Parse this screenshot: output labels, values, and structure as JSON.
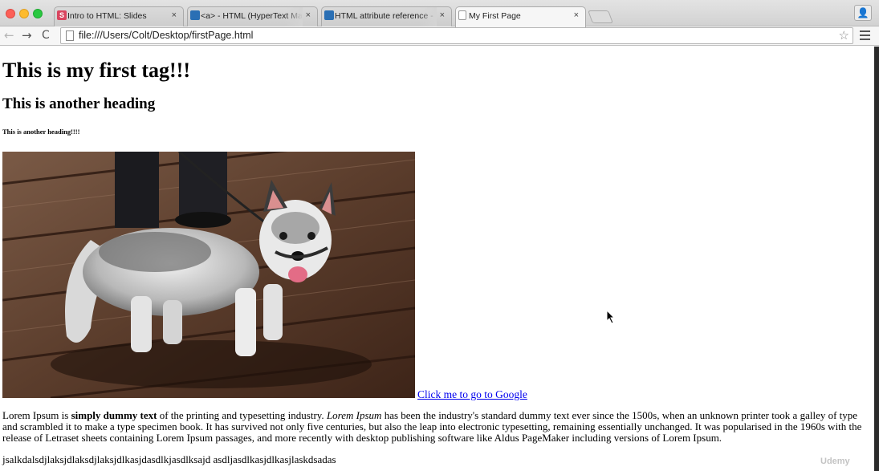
{
  "browser": {
    "tabs": [
      {
        "favicon": "slides-icon",
        "title": "Intro to HTML: Slides",
        "active": false
      },
      {
        "favicon": "mdn-icon",
        "title": "<a> - HTML (HyperText Ma",
        "active": false
      },
      {
        "favicon": "mdn-icon",
        "title": "HTML attribute reference -",
        "active": false
      },
      {
        "favicon": "document-icon",
        "title": "My First Page",
        "active": true
      }
    ],
    "favicon_letter": "S",
    "close_glyph": "×",
    "url": "file:///Users/Colt/Desktop/firstPage.html",
    "nav": {
      "back": "←",
      "forward": "→",
      "reload": "C",
      "star": "☆",
      "profile": "👤"
    },
    "colors": {
      "close": "#fc5f57",
      "minimize": "#fdbb2e",
      "maximize": "#29c840"
    }
  },
  "page": {
    "h1": "This is my first tag!!!",
    "h2": "This is another heading",
    "h6": "This is another heading!!!!",
    "image_alt": "husky-puppy-photo",
    "link_text": "Click me to go to Google",
    "paragraph": {
      "part1": "Lorem Ipsum is ",
      "bold": "simply dummy text",
      "part2": " of the printing and typesetting industry. ",
      "italic": "Lorem Ipsum",
      "part3": " has been the industry's standard dummy text ever since the 1500s, when an unknown printer took a galley of type and scrambled it to make a type specimen book. It has survived not only five centuries, but also the leap into electronic typesetting, remaining essentially unchanged. It was popularised in the 1960s with the release of Letraset sheets containing Lorem Ipsum passages, and more recently with desktop publishing software like Aldus PageMaker including versions of Lorem Ipsum."
    },
    "gibberish": "jsalkdalsdjlaksjdlaksdjlaksjdlkasjdasdlkjasdlksajd asdljasdlkasjdlkasjlaskdsadas",
    "watermark": "Udemy"
  }
}
